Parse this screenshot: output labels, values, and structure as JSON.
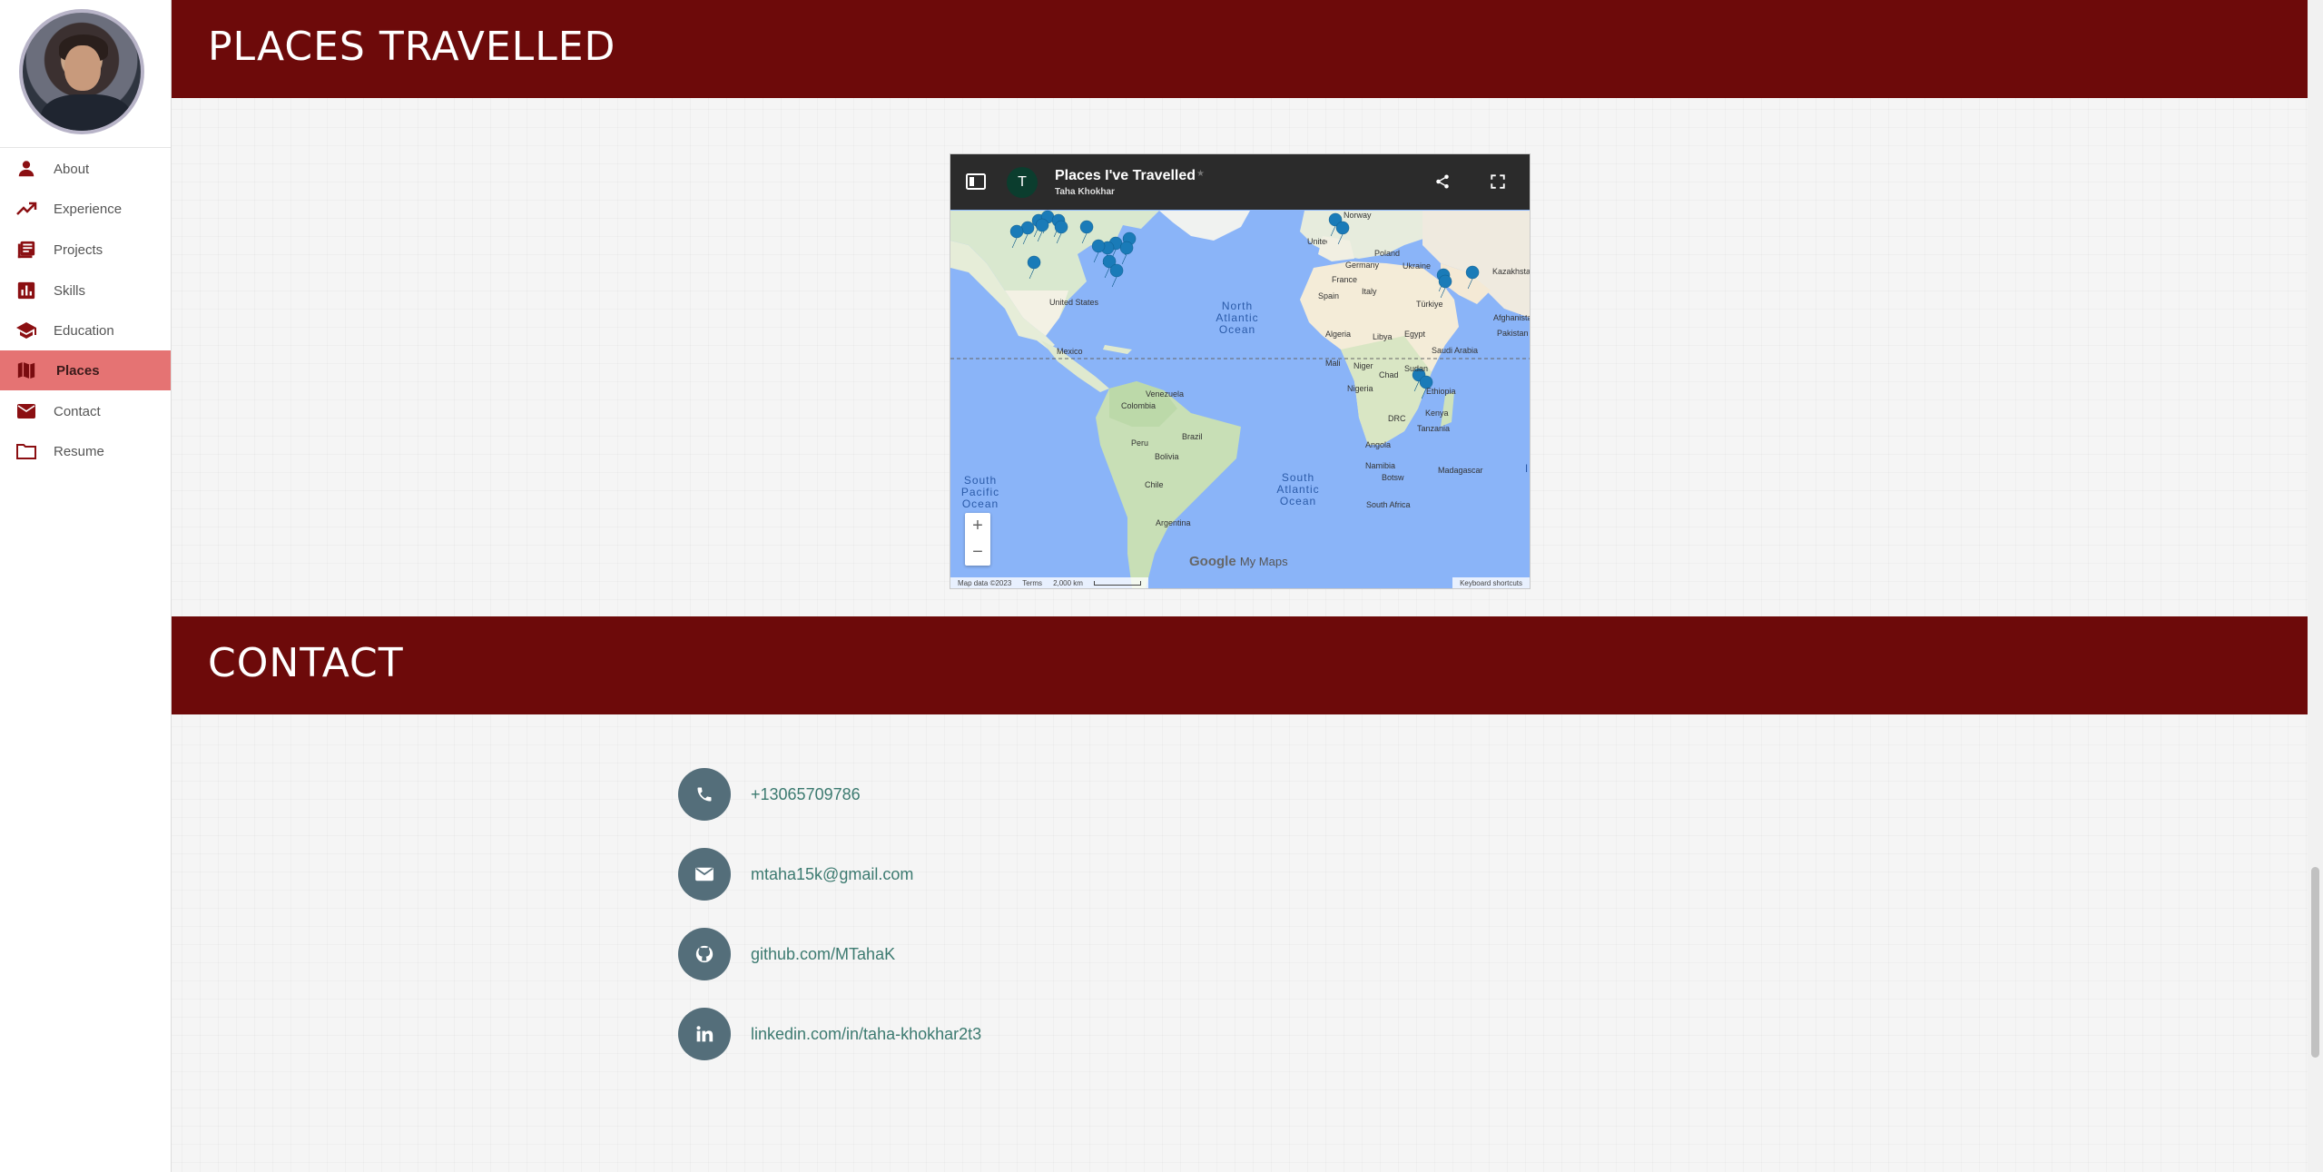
{
  "sidebar": {
    "items": [
      {
        "label": "About",
        "icon": "person-icon"
      },
      {
        "label": "Experience",
        "icon": "trending-up-icon"
      },
      {
        "label": "Projects",
        "icon": "newspaper-icon"
      },
      {
        "label": "Skills",
        "icon": "bar-chart-icon"
      },
      {
        "label": "Education",
        "icon": "graduation-cap-icon"
      },
      {
        "label": "Places",
        "icon": "map-icon",
        "active": true
      },
      {
        "label": "Contact",
        "icon": "mail-icon"
      },
      {
        "label": "Resume",
        "icon": "folder-icon"
      }
    ]
  },
  "places": {
    "heading": "PLACES TRAVELLED",
    "map": {
      "title": "Places I've Travelled",
      "author": "Taha Khokhar",
      "badge": "T",
      "logo_google": "Google",
      "logo_mymaps": "My Maps",
      "footer": {
        "data": "Map data ©2023",
        "terms": "Terms",
        "scale": "2,000 km",
        "shortcuts": "Keyboard shortcuts"
      },
      "labels": {
        "norway": "Norway",
        "uk": "United Kingdom",
        "poland": "Poland",
        "germany": "Germany",
        "ukraine": "Ukraine",
        "kazakhstan": "Kazakhstan",
        "france": "France",
        "italy": "Italy",
        "spain": "Spain",
        "turkiye": "Türkiye",
        "afghanistan": "Afghanistan",
        "pakistan": "Pakistan",
        "algeria": "Algeria",
        "libya": "Libya",
        "egypt": "Egypt",
        "saudi": "Saudi Arabia",
        "mali": "Mali",
        "niger": "Niger",
        "chad": "Chad",
        "sudan": "Sudan",
        "nigeria": "Nigeria",
        "ethiopia": "Ethiopia",
        "drc": "DRC",
        "kenya": "Kenya",
        "tanzania": "Tanzania",
        "angola": "Angola",
        "namibia": "Namibia",
        "botswana": "Botsw",
        "madagascar": "Madagascar",
        "southafrica": "South Africa",
        "us": "United States",
        "mexico": "Mexico",
        "venezuela": "Venezuela",
        "colombia": "Colombia",
        "brazil": "Brazil",
        "peru": "Peru",
        "bolivia": "Bolivia",
        "chile": "Chile",
        "argentina": "Argentina",
        "north_atlantic": "North Atlantic Ocean",
        "south_pacific": "South Pacific Ocean",
        "south_atlantic": "South Atlantic Ocean",
        "indian": "I"
      }
    }
  },
  "contact": {
    "heading": "CONTACT",
    "items": [
      {
        "icon": "phone-icon",
        "text": "+13065709786"
      },
      {
        "icon": "envelope-icon",
        "text": "mtaha15k@gmail.com"
      },
      {
        "icon": "github-icon",
        "text": "github.com/MTahaK"
      },
      {
        "icon": "linkedin-icon",
        "text": "linkedin.com/in/taha-khokhar2t3"
      }
    ]
  },
  "colors": {
    "header_band": "#6d0a0a",
    "active_nav": "#e57373",
    "contact_icon_bg": "#546e7a",
    "link": "#3c7a70"
  }
}
